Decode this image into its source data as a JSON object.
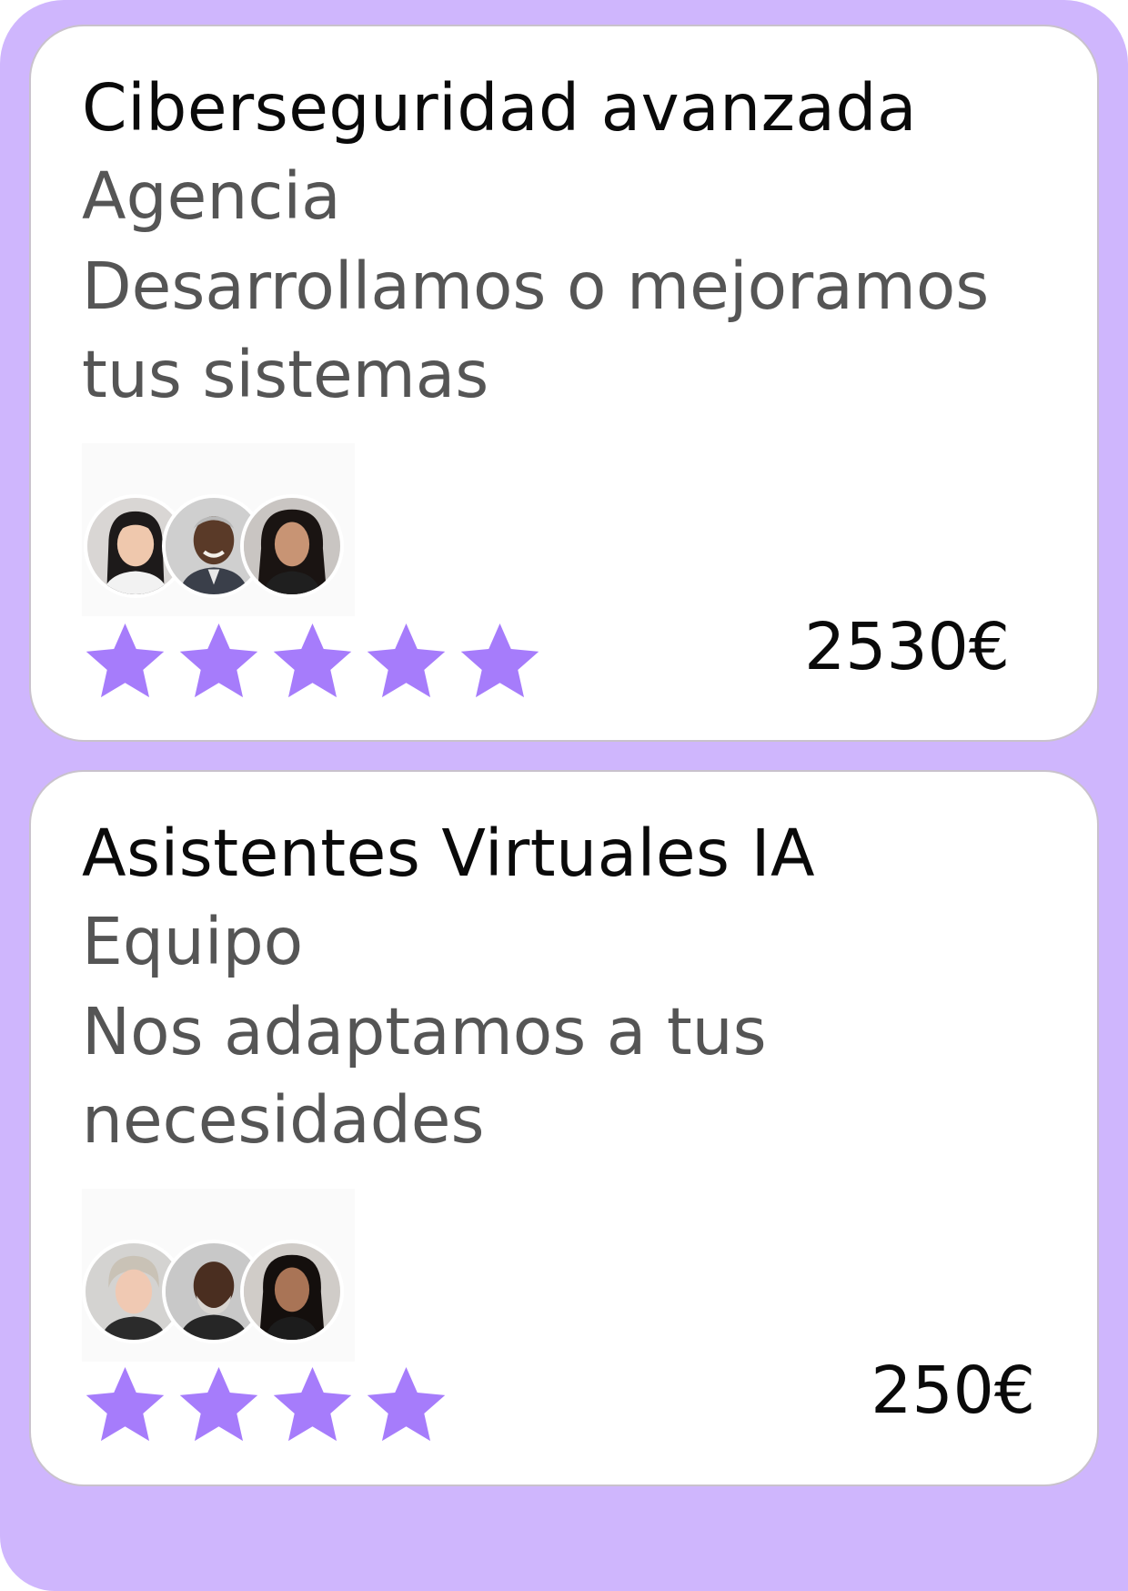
{
  "theme": {
    "background": "#cfb6fd",
    "card": "#ffffff",
    "star_color": "#a67cfb"
  },
  "cards": [
    {
      "title": "Ciberseguridad avanzada",
      "subtitle": "Agencia",
      "description": "Desarrollamos o mejoramos tus sistemas",
      "avatars": [
        "avatar-person",
        "avatar-person",
        "avatar-person"
      ],
      "rating": 5,
      "price": "2530€"
    },
    {
      "title": "Asistentes Virtuales IA",
      "subtitle": "Equipo",
      "description": "Nos adaptamos a tus necesidades",
      "avatars": [
        "avatar-person",
        "avatar-person",
        "avatar-person"
      ],
      "rating": 4,
      "price": "250€"
    }
  ]
}
